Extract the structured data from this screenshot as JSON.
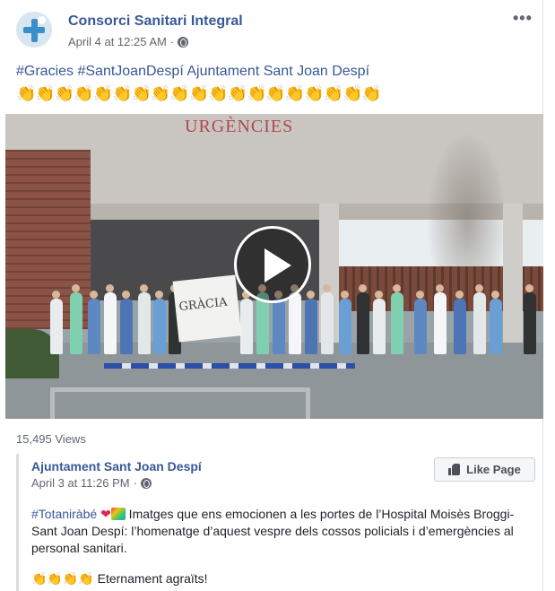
{
  "post": {
    "author": "Consorci Sanitari Integral",
    "timestamp": "April 4 at 12:25 AM",
    "separator": "·",
    "privacy_icon": "globe-icon",
    "more_icon": "•••",
    "text": "#Gracies #SantJoanDespí Ajuntament Sant Joan Despí",
    "emoji_row": "👏👏👏👏👏👏👏👏👏👏👏👏👏👏👏👏👏👏👏",
    "video": {
      "sign_text": "URGÈNCIES",
      "banner_text": "GRÀCIA",
      "play_icon": "play-icon"
    },
    "views": "15,495 Views"
  },
  "shared": {
    "author": "Ajuntament Sant Joan Despí",
    "timestamp": "April 3 at 11:26 PM",
    "separator": "·",
    "like_button": "Like Page",
    "hashtag": "#Totaniràbé",
    "body": " Imatges que ens emocionen a les portes de l’Hospital Moisès Broggi-Sant Joan Despí: l’homenatge d’aquest vespre dels cossos policials i d’emergències al personal sanitari.",
    "footer_emoji": "👏👏👏👏",
    "footer": " Eternament agraïts!"
  },
  "colors": {
    "link": "#385898",
    "meta": "#606770",
    "text": "#1d2129"
  }
}
